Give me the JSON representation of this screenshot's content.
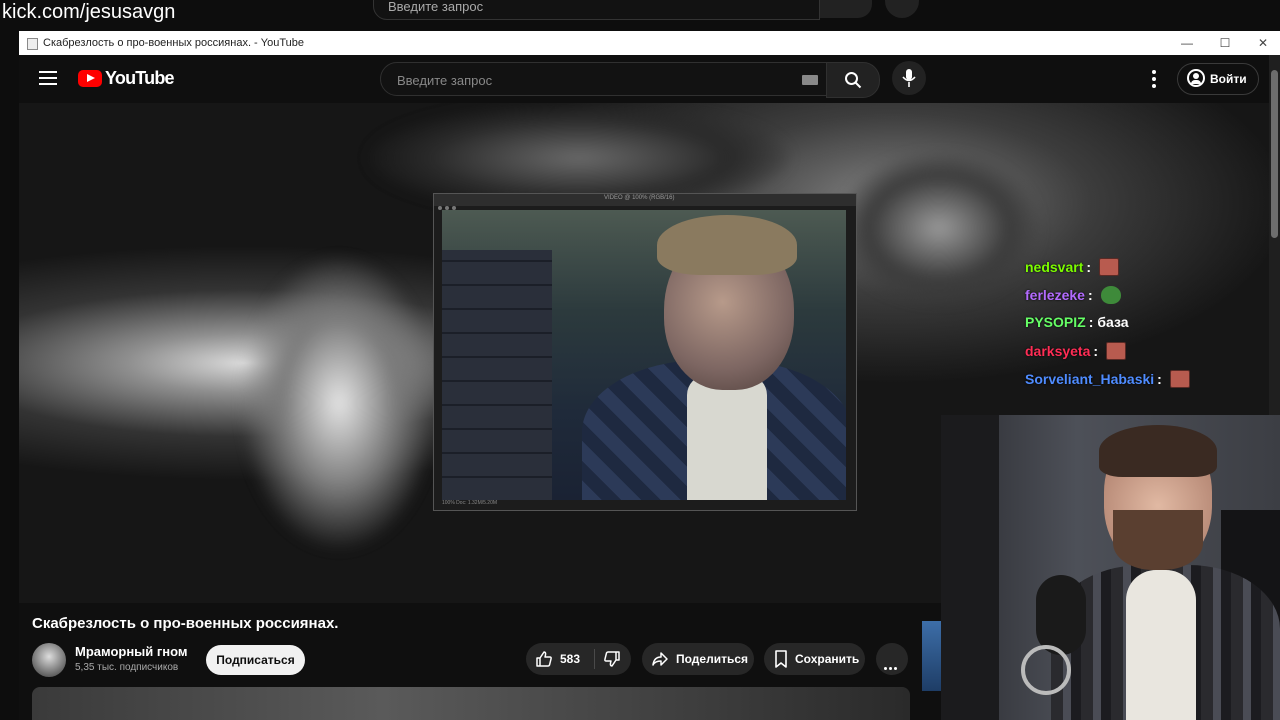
{
  "overlay": {
    "stream_url": "kick.com/jesusavgn",
    "background_search_placeholder": "Введите запрос"
  },
  "window": {
    "title": "Скабрезлость о про-военных россиянах. - YouTube",
    "minimize": "—",
    "maximize": "☐",
    "close": "✕"
  },
  "header": {
    "logo_text": "YouTube",
    "search_placeholder": "Введите запрос",
    "signin_label": "Войти"
  },
  "player": {
    "inner_window_title": "VIDEO @ 100% (RGB/16)",
    "inner_status": "100%   Doc: 1.32M/5.20M"
  },
  "chat": [
    {
      "user": "nedsvart",
      "color": "#7CFC00",
      "message": "",
      "emote": "face-emote"
    },
    {
      "user": "ferlezeke",
      "color": "#B36BFF",
      "message": "",
      "emote": "pepe-emote"
    },
    {
      "user": "PYSOPIZ",
      "color": "#66FF66",
      "message": "база",
      "emote": ""
    },
    {
      "user": "darksyeta",
      "color": "#FF2D55",
      "message": "",
      "emote": "face-emote"
    },
    {
      "user": "Sorveliant_Habaski",
      "color": "#4F8CFF",
      "message": "",
      "emote": "face-emote"
    }
  ],
  "video": {
    "title": "Скабрезлость о про-военных россиянах.",
    "channel_name": "Мраморный гном",
    "subscribers": "5,35 тыс. подписчиков",
    "subscribe_label": "Подписаться",
    "like_count": "583",
    "share_label": "Поделиться",
    "save_label": "Сохранить"
  },
  "colors": {
    "brand_red": "#FF0000",
    "page_bg": "#0F0F0F",
    "button_bg": "#272727"
  }
}
